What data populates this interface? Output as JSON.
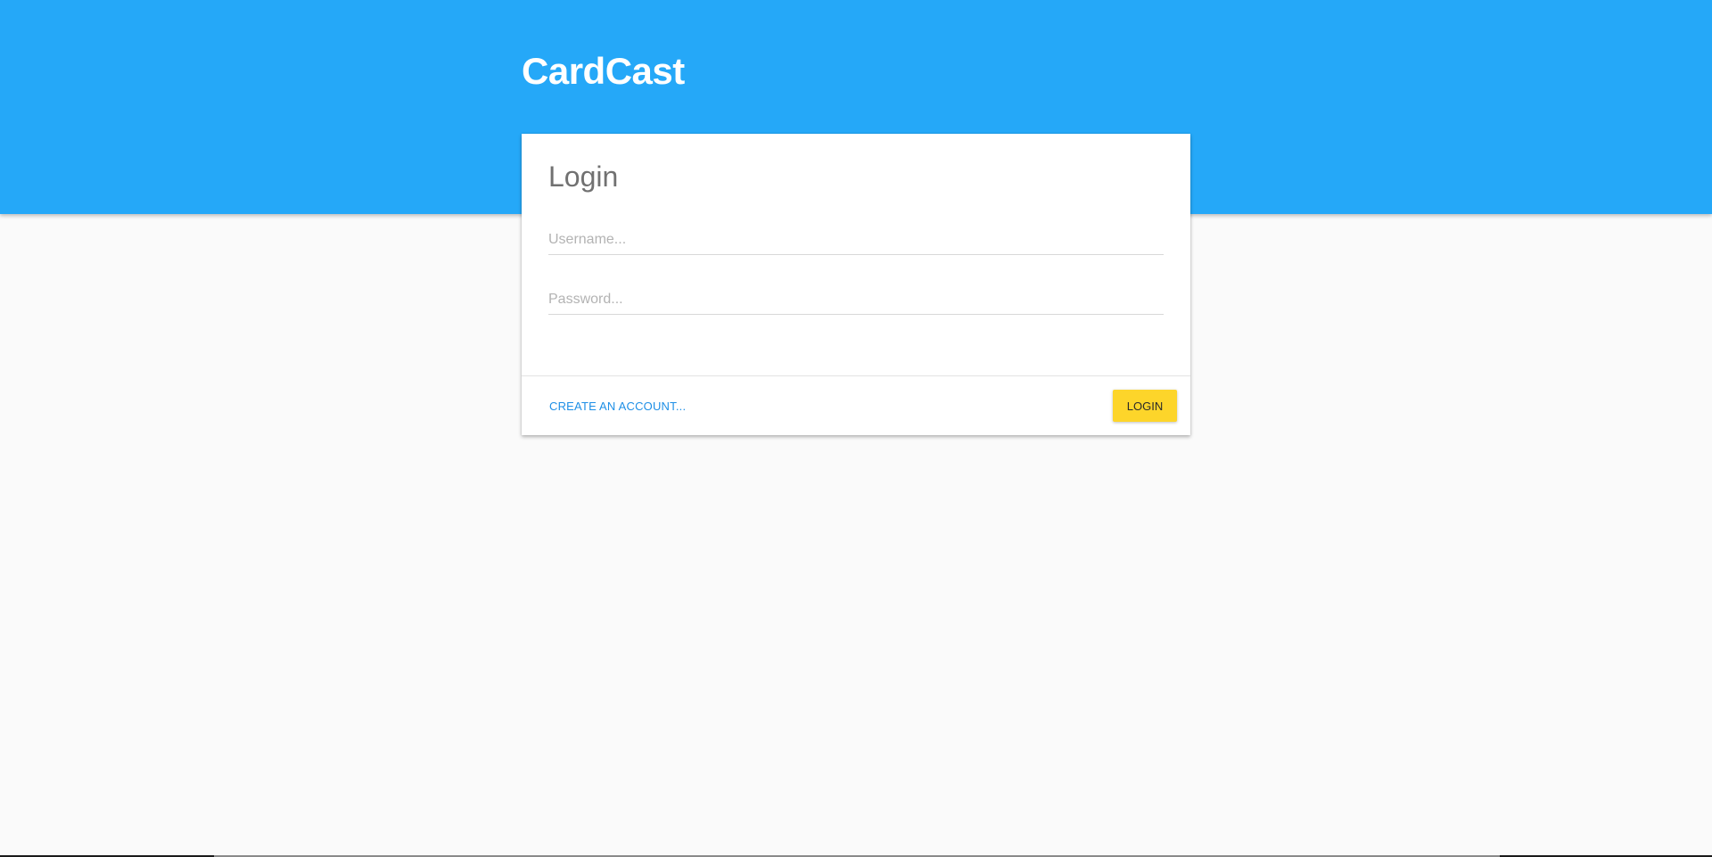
{
  "header": {
    "app_name": "CardCast"
  },
  "login_card": {
    "title": "Login",
    "username": {
      "placeholder": "Username...",
      "value": ""
    },
    "password": {
      "placeholder": "Password...",
      "value": ""
    },
    "footer": {
      "create_account_label": "CREATE AN ACCOUNT...",
      "login_button_label": "LOGIN"
    }
  },
  "colors": {
    "header_background": "#25a8f8",
    "page_background": "#fafafa",
    "link": "#1e8fe6",
    "login_button": "#fdd52a"
  }
}
